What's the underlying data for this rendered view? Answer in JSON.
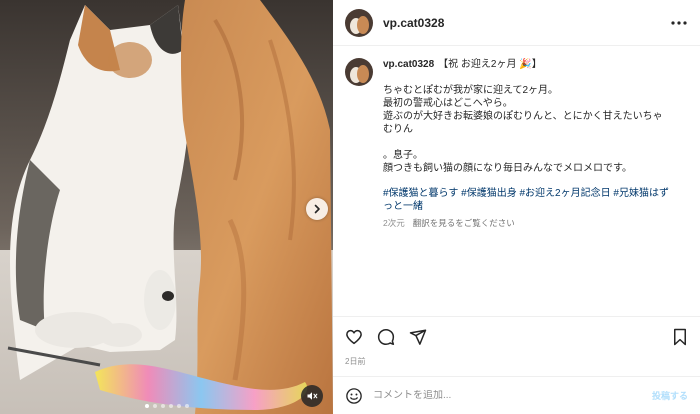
{
  "post": {
    "username": "vp.cat0328",
    "caption_title": "【祝 お迎え2ヶ月 🎉】",
    "caption_lines": [
      "ちゃむとぽむが我が家に迎えて2ヶ月。",
      "最初の警戒心はどこへやら。",
      "遊ぶのが大好きお転婆娘のぽむりんと、とにかく甘えたいちゃ",
      "むりん",
      "",
      "。息子。",
      "顔つきも飼い猫の顔になり毎日みんなでメロメロです。"
    ],
    "hashtags_line1": "#保護猫と暮らす #保護猫出身 #お迎え2ヶ月記念日 #兄妹猫はず",
    "hashtags_line2": "っと一緒",
    "caption_age": "2次元",
    "translate_label": "翻訳を見るをご覧ください",
    "posted_time": "2日前"
  },
  "media": {
    "carousel_count": 6,
    "active_index": 0
  },
  "comment": {
    "placeholder": "コメントを追加...",
    "post_label": "投稿する"
  },
  "icons": {
    "more": "more-horizontal-icon",
    "like": "heart-icon",
    "comment": "comment-icon",
    "share": "send-icon",
    "save": "bookmark-icon",
    "emoji": "emoji-icon",
    "next": "chevron-right-icon",
    "mute": "speaker-muted-icon"
  },
  "colors": {
    "hashtag": "#00376b",
    "secondary_text": "#8e8e8e",
    "post_button": "#b2dffc"
  }
}
